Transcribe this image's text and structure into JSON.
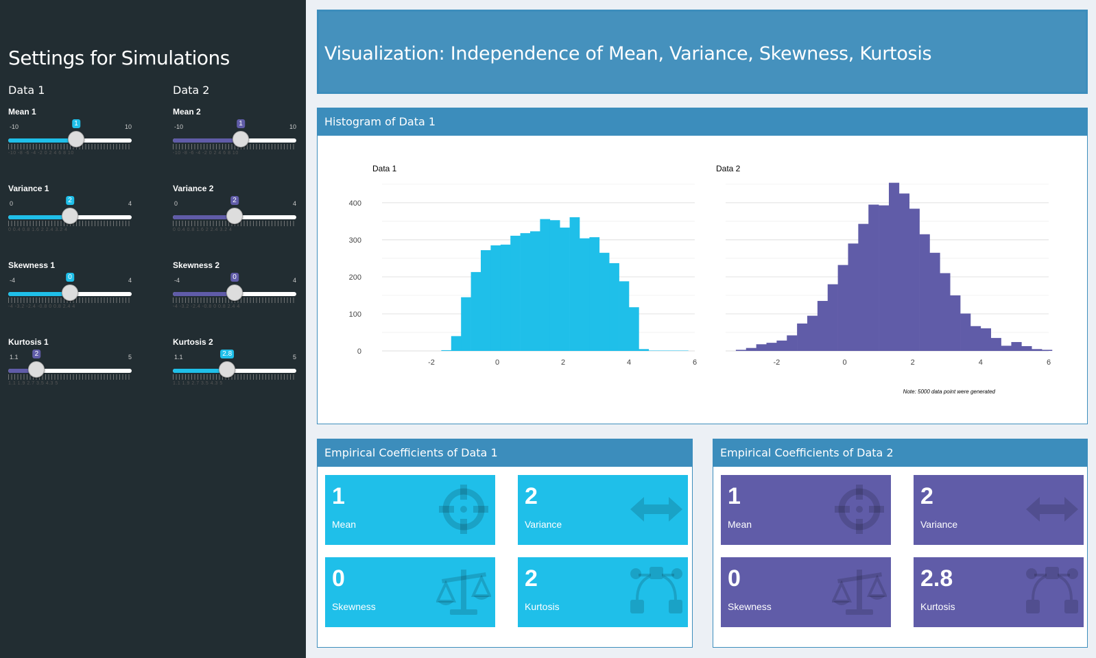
{
  "sidebar": {
    "title": "Settings for Simulations",
    "col1_title": "Data 1",
    "col2_title": "Data 2",
    "sliders": [
      {
        "label": "Mean 1",
        "min": "-10",
        "max": "10",
        "value": "1",
        "fraction": 0.55,
        "color": "#1fbfe9",
        "ticks": "-10 -8 -6 -4 -2  0  2  4  6  8 10"
      },
      {
        "label": "Variance 1",
        "min": "0",
        "max": "4",
        "value": "2",
        "fraction": 0.5,
        "color": "#1fbfe9",
        "ticks": "0  0.4 0.8    1.6  2  2.4    3.2    4"
      },
      {
        "label": "Skewness 1",
        "min": "-4",
        "max": "4",
        "value": "0",
        "fraction": 0.5,
        "color": "#1fbfe9",
        "ticks": "-4 -3.2 -2.4   -0.8  0  0.8    2.4    4"
      },
      {
        "label": "Kurtosis 1",
        "min": "1.1",
        "max": "5",
        "value": "2",
        "fraction": 0.23,
        "color": "#605ca8",
        "ticks": "1.1   1.9   2.7   3.5   4.3   5"
      },
      {
        "label": "Mean 2",
        "min": "-10",
        "max": "10",
        "value": "1",
        "fraction": 0.55,
        "color": "#605ca8",
        "ticks": "-10 -8 -6 -4 -2  0  2  4  6  8 10"
      },
      {
        "label": "Variance 2",
        "min": "0",
        "max": "4",
        "value": "2",
        "fraction": 0.5,
        "color": "#605ca8",
        "ticks": "0  0.4 0.8    1.6  2  2.4    3.2    4"
      },
      {
        "label": "Skewness 2",
        "min": "-4",
        "max": "4",
        "value": "0",
        "fraction": 0.5,
        "color": "#605ca8",
        "ticks": "-4 -3.2 -2.4   -0.8  0  0.8    2.4    4"
      },
      {
        "label": "Kurtosis 2",
        "min": "1.1",
        "max": "5",
        "value": "2.8",
        "fraction": 0.44,
        "color": "#1fbfe9",
        "ticks": "1.1   1.9   2.7   3.5   4.3   5"
      }
    ]
  },
  "header": {
    "title": "Visualization: Independence of Mean, Variance, Skewness, Kurtosis"
  },
  "histogram_box": {
    "title": "Histogram of Data 1",
    "note": "Note: 5000 data point were generated"
  },
  "coef1": {
    "title": "Empirical Coefficients of Data 1",
    "items": [
      {
        "value": "1",
        "label": "Mean",
        "icon": "crosshairs-icon"
      },
      {
        "value": "2",
        "label": "Variance",
        "icon": "arrows-h-icon"
      },
      {
        "value": "0",
        "label": "Skewness",
        "icon": "balance-scale-icon"
      },
      {
        "value": "2",
        "label": "Kurtosis",
        "icon": "bezier-curve-icon"
      }
    ]
  },
  "coef2": {
    "title": "Empirical Coefficients of Data 2",
    "items": [
      {
        "value": "1",
        "label": "Mean",
        "icon": "crosshairs-icon"
      },
      {
        "value": "2",
        "label": "Variance",
        "icon": "arrows-h-icon"
      },
      {
        "value": "0",
        "label": "Skewness",
        "icon": "balance-scale-icon"
      },
      {
        "value": "2.8",
        "label": "Kurtosis",
        "icon": "bezier-curve-icon"
      }
    ]
  },
  "colors": {
    "data1": "#1fbfe9",
    "data2": "#605ca8",
    "header": "#3c8dbc",
    "sidebar": "#222d32"
  },
  "chart_data": [
    {
      "type": "bar",
      "title": "Data 1",
      "xlim": [
        -3.5,
        6
      ],
      "ylim": [
        0,
        470
      ],
      "xticks": [
        -2,
        0,
        2,
        4,
        6
      ],
      "yticks": [
        0,
        100,
        200,
        300,
        400
      ],
      "bin_width": 0.3,
      "bin_start": -3.5,
      "values": [
        0,
        0,
        0,
        0,
        0,
        0,
        2,
        40,
        145,
        213,
        272,
        285,
        287,
        311,
        318,
        323,
        356,
        353,
        333,
        361,
        304,
        307,
        265,
        237,
        188,
        118,
        5,
        1,
        1,
        1,
        1,
        0
      ],
      "color": "#1fbfe9"
    },
    {
      "type": "bar",
      "title": "Data 2",
      "xlim": [
        -3.5,
        6
      ],
      "ylim": [
        0,
        470
      ],
      "xticks": [
        -2,
        0,
        2,
        4,
        6
      ],
      "yticks": [
        0,
        100,
        200,
        300,
        400
      ],
      "bin_width": 0.3,
      "bin_start": -3.5,
      "values": [
        0,
        3,
        8,
        18,
        22,
        28,
        42,
        74,
        95,
        135,
        180,
        232,
        290,
        343,
        395,
        393,
        454,
        425,
        384,
        315,
        265,
        210,
        150,
        101,
        67,
        61,
        35,
        14,
        24,
        13,
        5,
        3
      ],
      "color": "#605ca8"
    }
  ]
}
